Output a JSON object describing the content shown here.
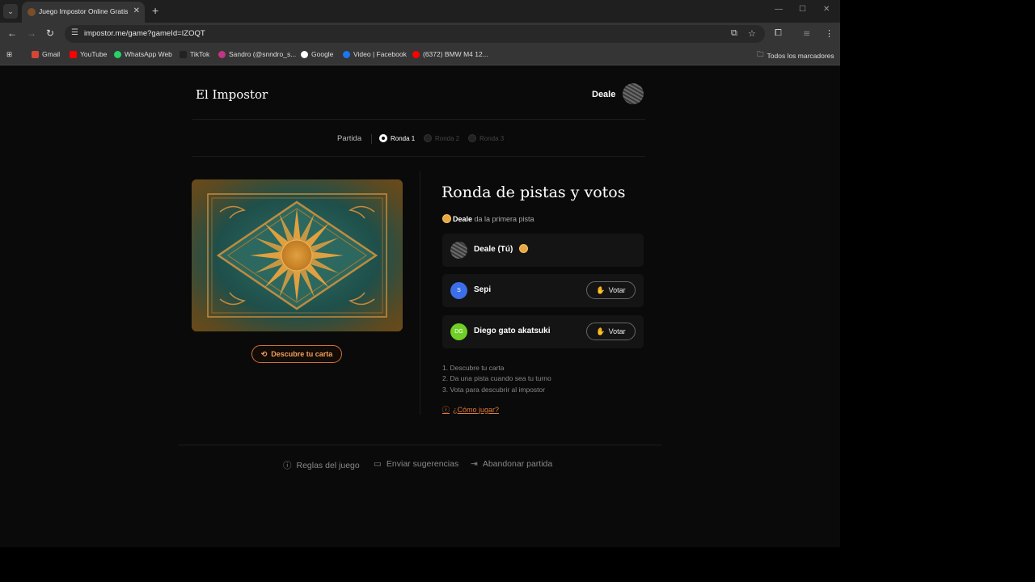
{
  "browser": {
    "tab_title": "Juego Impostor Online Gratis -",
    "url": "impostor.me/game?gameId=IZOQT",
    "bookmarks": [
      {
        "label": "Gmail",
        "color": "#d44638"
      },
      {
        "label": "YouTube",
        "color": "#ff0000"
      },
      {
        "label": "WhatsApp Web",
        "color": "#25d366"
      },
      {
        "label": "TikTok",
        "color": "#222222"
      },
      {
        "label": "Sandro (@snndro_s...",
        "color": "#c13584"
      },
      {
        "label": "Google",
        "color": "#ffffff"
      },
      {
        "label": "Video | Facebook",
        "color": "#1877f2"
      },
      {
        "label": "(6372) BMW M4 12...",
        "color": "#ff0000"
      }
    ],
    "all_bookmarks": "Todos los marcadores"
  },
  "header": {
    "logo": "El Impostor",
    "user_name": "Deale"
  },
  "progress": {
    "label": "Partida",
    "rounds": [
      {
        "label": "Ronda 1",
        "active": true
      },
      {
        "label": "Ronda 2",
        "active": false
      },
      {
        "label": "Ronda 3",
        "active": false
      }
    ]
  },
  "card": {
    "reveal_label": "Descubre tu carta"
  },
  "round": {
    "title": "Ronda de pistas y votos",
    "clue_player": "Deale",
    "clue_text": " da la primera pista",
    "players": [
      {
        "name": "Deale (Tú)",
        "initials": "",
        "avatar_color": "#555555",
        "is_self": true
      },
      {
        "name": "Sepi",
        "initials": "S",
        "avatar_color": "#3b6ee8",
        "is_self": false
      },
      {
        "name": "Diego gato akatsuki",
        "initials": "DG",
        "avatar_color": "#6fcf26",
        "is_self": false
      }
    ],
    "vote_label": "Votar",
    "instructions": [
      "1. Descubre tu carta",
      "2. Da una pista cuando sea tu turno",
      "3. Vota para descubrir al impostor"
    ],
    "how_to": "¿Cómo jugar?"
  },
  "footer": {
    "rules": "Reglas del juego",
    "suggestions": "Enviar sugerencias",
    "leave": "Abandonar partida"
  },
  "colors": {
    "accent": "#e07a3a",
    "background": "#0a0a0a"
  }
}
